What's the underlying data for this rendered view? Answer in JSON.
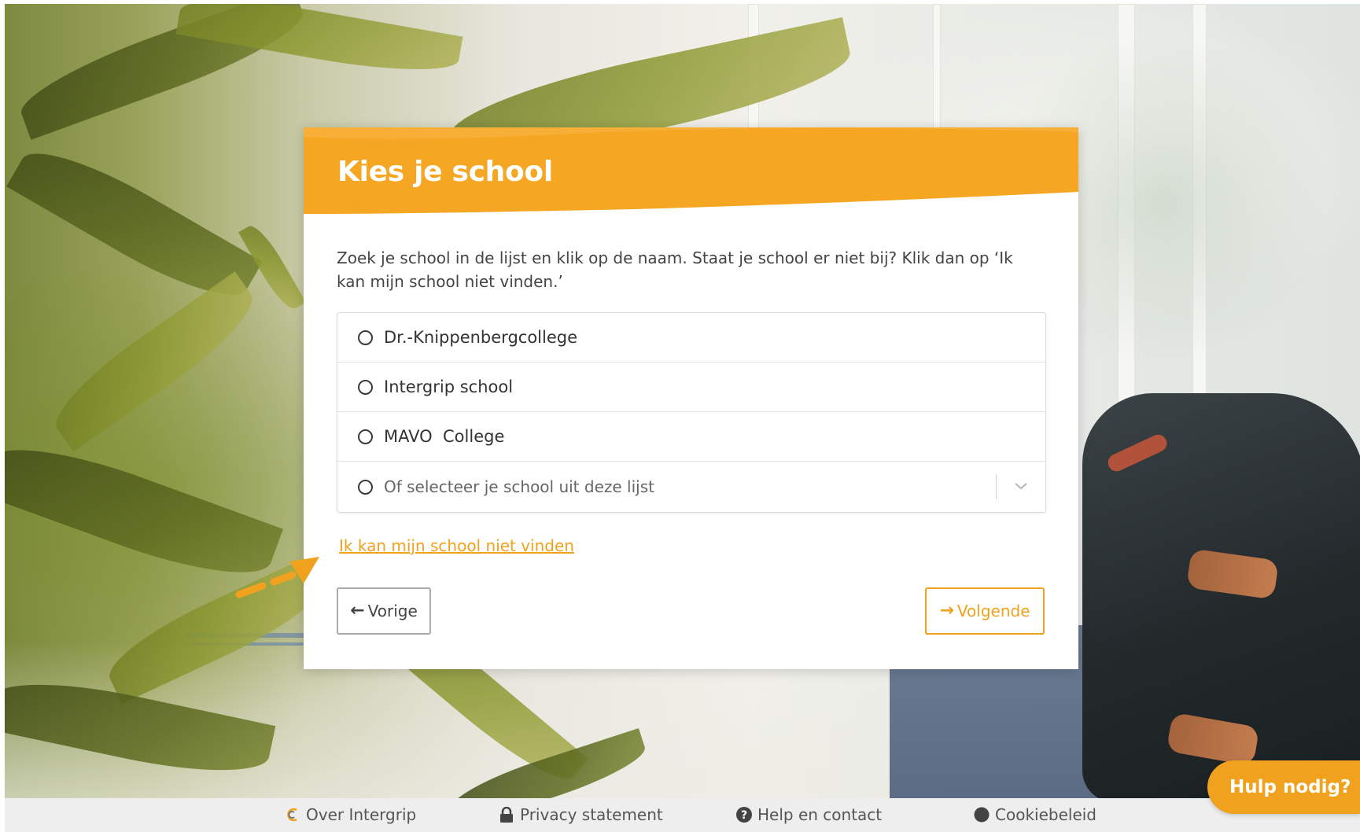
{
  "modal": {
    "title": "Kies je school",
    "intro": "Zoek je school in de lijst en klik op de naam. Staat je school er niet bij? Klik dan op ‘Ik kan mijn school niet vinden.’",
    "schools": [
      {
        "label": "Dr.-Knippenbergcollege"
      },
      {
        "label": "Intergrip school"
      },
      {
        "label": "MAVO  College"
      }
    ],
    "select_placeholder": "Of selecteer je school uit deze lijst",
    "cant_find_link": "Ik kan mijn school niet vinden",
    "prev_label": "Vorige",
    "next_label": "Volgende",
    "accent_color": "#f0a21e"
  },
  "footer": {
    "links": [
      {
        "label": "Over Intergrip",
        "icon": "intergrip-logo-icon"
      },
      {
        "label": "Privacy statement",
        "icon": "lock-icon"
      },
      {
        "label": "Help en contact",
        "icon": "question-circle-icon"
      },
      {
        "label": "Cookiebeleid",
        "icon": "circle-icon"
      }
    ]
  },
  "help_bubble": {
    "label": "Hulp nodig?"
  }
}
